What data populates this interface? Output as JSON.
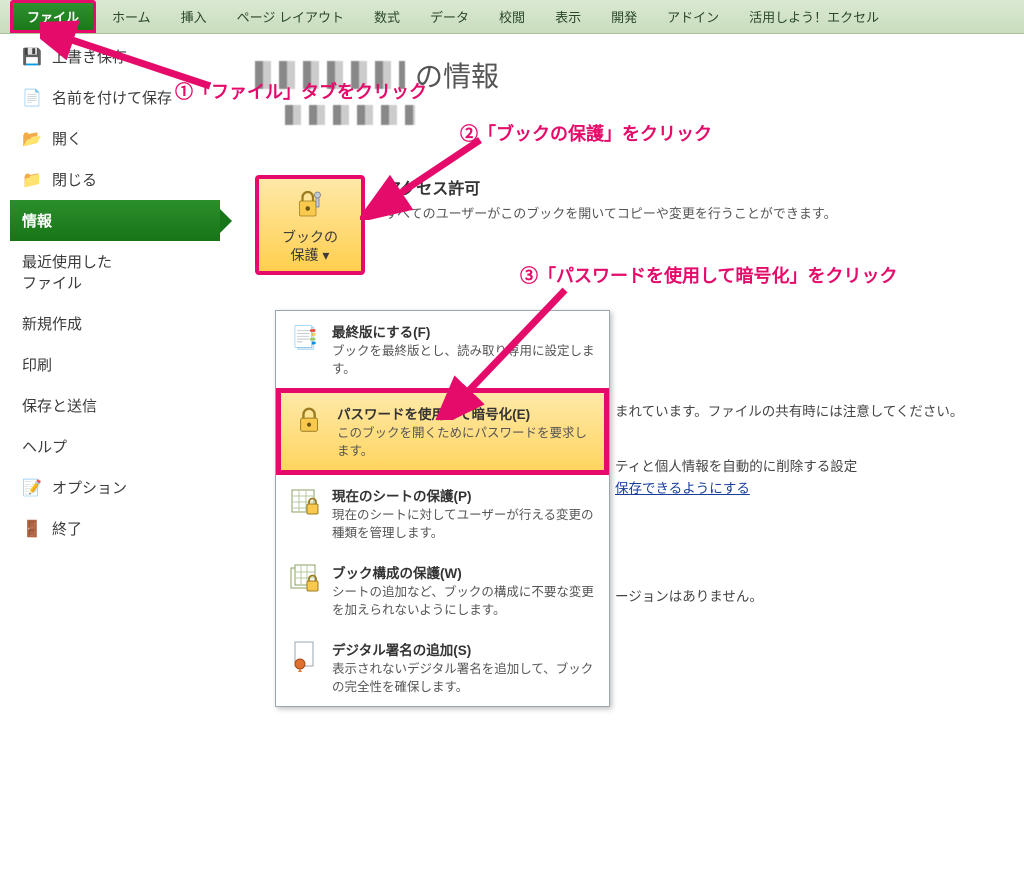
{
  "ribbon": {
    "tabs": [
      "ファイル",
      "ホーム",
      "挿入",
      "ページ レイアウト",
      "数式",
      "データ",
      "校閲",
      "表示",
      "開発",
      "アドイン",
      "活用しよう！エクセル"
    ]
  },
  "rail": {
    "items": [
      {
        "icon": "save",
        "label": "上書き保存"
      },
      {
        "icon": "saveas",
        "label": "名前を付けて保存"
      },
      {
        "icon": "open",
        "label": "開く"
      },
      {
        "icon": "close",
        "label": "閉じる"
      },
      {
        "icon": "",
        "label": "情報",
        "selected": true
      },
      {
        "icon": "",
        "label": "最近使用した\nファイル"
      },
      {
        "icon": "",
        "label": "新規作成"
      },
      {
        "icon": "",
        "label": "印刷"
      },
      {
        "icon": "",
        "label": "保存と送信"
      },
      {
        "icon": "",
        "label": "ヘルプ"
      },
      {
        "icon": "opts",
        "label": "オプション"
      },
      {
        "icon": "exit",
        "label": "終了"
      }
    ]
  },
  "main": {
    "title_suffix": "の情報",
    "access": {
      "head": "アクセス許可",
      "desc": "すべてのユーザーがこのブックを開いてコピーや変更を行うことができます。"
    },
    "protect_btn": {
      "line1": "ブックの",
      "line2": "保護 ▾"
    },
    "right_fragments": {
      "share_tail": "まれています。ファイルの共有時には注意してください。",
      "privacy_tail": "ティと個人情報を自動的に削除する設定",
      "privacy_link": "保存できるようにする",
      "version_tail": "ージョンはありません。"
    }
  },
  "protect_menu": {
    "items": [
      {
        "title": "最終版にする(F)",
        "desc": "ブックを最終版とし、読み取り専用に設定します。",
        "icon": "final"
      },
      {
        "title": "パスワードを使用して暗号化(E)",
        "desc": "このブックを開くためにパスワードを要求します。",
        "icon": "lock",
        "highlight": true
      },
      {
        "title": "現在のシートの保護(P)",
        "desc": "現在のシートに対してユーザーが行える変更の種類を管理します。",
        "icon": "sheet"
      },
      {
        "title": "ブック構成の保護(W)",
        "desc": "シートの追加など、ブックの構成に不要な変更を加えられないようにします。",
        "icon": "sheet"
      },
      {
        "title": "デジタル署名の追加(S)",
        "desc": "表示されないデジタル署名を追加して、ブックの完全性を確保します。",
        "icon": "sign"
      }
    ]
  },
  "callouts": {
    "c1": "①「ファイル」タブをクリック",
    "c2": "②「ブックの保護」をクリック",
    "c3": "③「パスワードを使用して暗号化」をクリック"
  }
}
